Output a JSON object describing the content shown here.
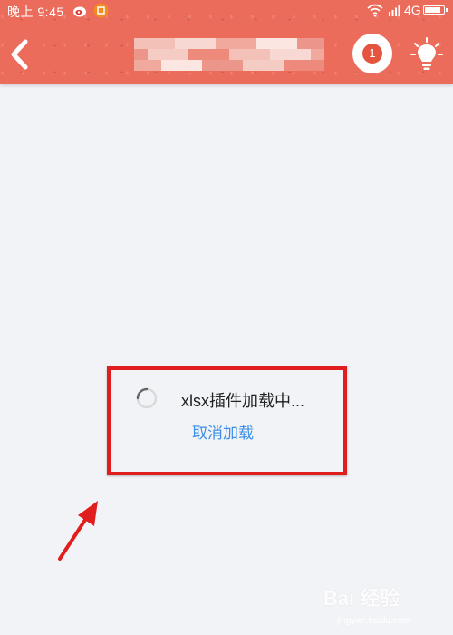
{
  "status_bar": {
    "time": "晚上 9:45",
    "network": "4G",
    "battery_level": 0.9
  },
  "header": {
    "notification_count": "1"
  },
  "dialog": {
    "loading_text": "xlsx插件加载中...",
    "cancel_label": "取消加载"
  },
  "watermark": {
    "brand": "Bai 经验",
    "url": "jingyan.baidu.com"
  },
  "colors": {
    "header_bg": "#ec6c5c",
    "page_bg": "#f2f3f7",
    "link": "#3a8ee6",
    "highlight_border": "#e01e1e"
  },
  "icons": [
    "back-arrow-icon",
    "notification-badge-icon",
    "lightbulb-icon",
    "wifi-icon",
    "signal-icon",
    "battery-icon",
    "loading-spinner-icon"
  ]
}
